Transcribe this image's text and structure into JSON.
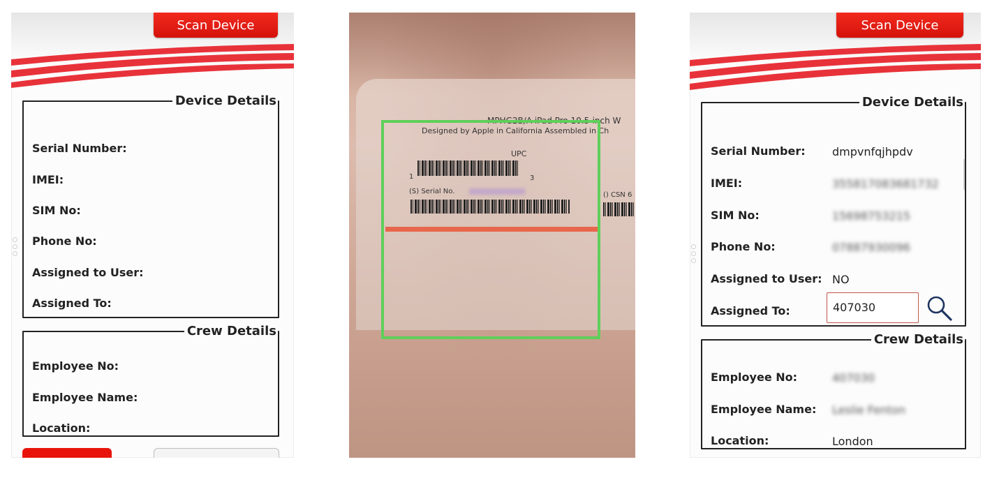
{
  "left_screen": {
    "scan_button": "Scan Device",
    "device_details": {
      "legend": "Device Details",
      "rows": [
        {
          "label": "Serial Number:"
        },
        {
          "label": "IMEI:"
        },
        {
          "label": "SIM No:"
        },
        {
          "label": "Phone No:"
        },
        {
          "label": "Assigned to User:"
        },
        {
          "label": "Assigned To:"
        }
      ]
    },
    "crew_details": {
      "legend": "Crew Details",
      "rows": [
        {
          "label": "Employee No:"
        },
        {
          "label": "Employee Name:"
        },
        {
          "label": "Location:"
        }
      ]
    }
  },
  "camera_screen": {
    "label_model": "MPHG2B/A iPad Pro 10.5-inch W",
    "label_designed": "Designed by Apple in California  Assembled in Ch",
    "label_upc": "UPC",
    "label_digit_left": "1",
    "label_digit_right": "3",
    "label_serial": "(S) Serial No.",
    "label_csn": "() CSN 6",
    "colors": {
      "frame": "#5fcf5a",
      "scan_line": "#e8674c"
    }
  },
  "right_screen": {
    "scan_button": "Scan Device",
    "device_details": {
      "legend": "Device Details",
      "serial_label": "Serial Number:",
      "serial_value": "dmpvnfqjhpdv",
      "imei_label": "IMEI:",
      "imei_value": "355817083681732",
      "sim_label": "SIM No:",
      "sim_value": "15698753215",
      "phone_label": "Phone No:",
      "phone_value": "07887930096",
      "assigned_user_label": "Assigned to User:",
      "assigned_user_value": "NO",
      "assigned_to_label": "Assigned To:",
      "assigned_to_value": "407030",
      "search_icon": "search-icon"
    },
    "crew_details": {
      "legend": "Crew Details",
      "employee_no_label": "Employee No:",
      "employee_no_value": "407030",
      "employee_name_label": "Employee Name:",
      "employee_name_value": "Leslie Fenton",
      "location_label": "Location:",
      "location_value": "London"
    }
  },
  "theme": {
    "accent": "#e8140b",
    "swoosh": "#e8323a"
  }
}
